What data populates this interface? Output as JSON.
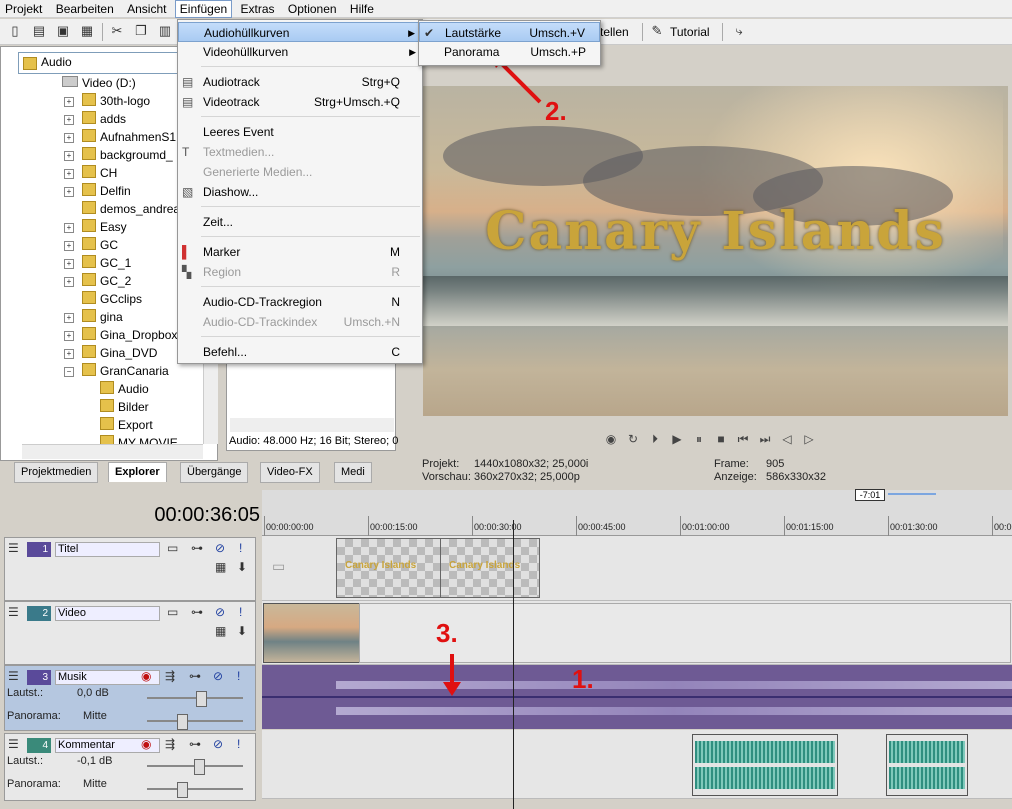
{
  "menubar": {
    "items": [
      "Projekt",
      "Bearbeiten",
      "Ansicht",
      "Einfügen",
      "Extras",
      "Optionen",
      "Hilfe"
    ],
    "active": "Einfügen"
  },
  "toolbar": {
    "tutorial_label": "Tutorial",
    "partial_label": "tellen"
  },
  "explorer": {
    "combo_value": "Audio",
    "drive": "Video (D:)",
    "folders": [
      "30th-logo",
      "adds",
      "AufnahmenS1",
      "backgroumd_",
      "CH",
      "Delfin",
      "demos_andrea",
      "Easy",
      "GC",
      "GC_1",
      "GC_2",
      "GCclips",
      "gina",
      "Gina_Dropbox",
      "Gina_DVD",
      "GranCanaria",
      "Audio",
      "Bilder",
      "Export",
      "MY MOVIE"
    ],
    "audio_info": "Audio: 48.000 Hz; 16 Bit; Stereo; 0"
  },
  "tabs": [
    "Projektmedien",
    "Explorer",
    "Übergänge",
    "Video-FX",
    "Medi"
  ],
  "preview": {
    "title_text": "Canary Islands",
    "projekt_label": "Projekt:",
    "projekt_value": "1440x1080x32; 25,000i",
    "vorschau_label": "Vorschau:",
    "vorschau_value": "360x270x32; 25,000p",
    "frame_label": "Frame:",
    "frame_value": "905",
    "anzeige_label": "Anzeige:",
    "anzeige_value": "586x330x32"
  },
  "timeline": {
    "time": "00:00:36:05",
    "marker_value": "-7:01",
    "ruler": [
      "00:00:00:00",
      "00:00:15:00",
      "00:00:30:00",
      "00:00:45:00",
      "00:01:00:00",
      "00:01:15:00",
      "00:01:30:00",
      "00:0"
    ]
  },
  "tracks": [
    {
      "num": "1",
      "name": "Titel",
      "color": "#5a4a9a"
    },
    {
      "num": "2",
      "name": "Video",
      "color": "#3a7a8a"
    },
    {
      "num": "3",
      "name": "Musik",
      "color": "#5a4a9a",
      "vol_label": "Lautst.:",
      "vol_value": "0,0 dB",
      "pan_label": "Panorama:",
      "pan_value": "Mitte"
    },
    {
      "num": "4",
      "name": "Kommentar",
      "color": "#3a8a7a",
      "vol_label": "Lautst.:",
      "vol_value": "-0,1 dB",
      "pan_label": "Panorama:",
      "pan_value": "Mitte"
    }
  ],
  "clips": {
    "title_clip_a": "Canary Islands",
    "title_clip_b": "Canary Islands"
  },
  "einfuegen_menu": [
    {
      "label": "Audiohüllkurven",
      "shortcut": "",
      "submenu": true,
      "disabled": false,
      "icon": ""
    },
    {
      "label": "Videohüllkurven",
      "shortcut": "",
      "submenu": true,
      "disabled": false,
      "icon": ""
    },
    {
      "label": "Audiotrack",
      "shortcut": "Strg+Q",
      "disabled": false,
      "icon": "audiotrack-icon"
    },
    {
      "label": "Videotrack",
      "shortcut": "Strg+Umsch.+Q",
      "disabled": false,
      "icon": "videotrack-icon"
    },
    {
      "label": "Leeres Event",
      "shortcut": "",
      "disabled": false,
      "icon": ""
    },
    {
      "label": "Textmedien...",
      "shortcut": "",
      "disabled": true,
      "icon": "text-media-icon"
    },
    {
      "label": "Generierte Medien...",
      "shortcut": "",
      "disabled": true,
      "icon": ""
    },
    {
      "label": "Diashow...",
      "shortcut": "",
      "disabled": false,
      "icon": "slideshow-icon"
    },
    {
      "label": "Zeit...",
      "shortcut": "",
      "disabled": false,
      "icon": ""
    },
    {
      "label": "Marker",
      "shortcut": "M",
      "disabled": false,
      "icon": "marker-icon"
    },
    {
      "label": "Region",
      "shortcut": "R",
      "disabled": true,
      "icon": "region-icon"
    },
    {
      "label": "Audio-CD-Trackregion",
      "shortcut": "N",
      "disabled": false,
      "icon": ""
    },
    {
      "label": "Audio-CD-Trackindex",
      "shortcut": "Umsch.+N",
      "disabled": true,
      "icon": ""
    },
    {
      "label": "Befehl...",
      "shortcut": "C",
      "disabled": false,
      "icon": ""
    }
  ],
  "submenu": [
    {
      "label": "Lautstärke",
      "shortcut": "Umsch.+V",
      "checked": true
    },
    {
      "label": "Panorama",
      "shortcut": "Umsch.+P",
      "checked": false
    }
  ],
  "annotations": [
    "1.",
    "2.",
    "3."
  ],
  "colors": {
    "accent": "#e01010",
    "audio_lane": "#6e5a94",
    "menu_highlight": "#a9cbf2"
  }
}
